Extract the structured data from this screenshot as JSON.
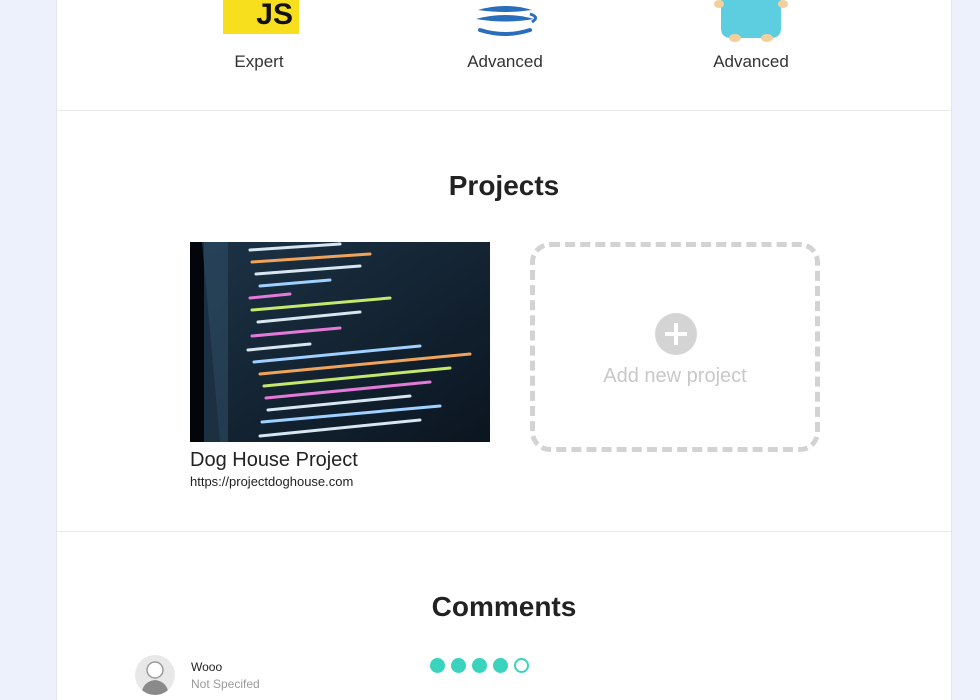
{
  "skills": [
    {
      "icon": "javascript-logo-icon",
      "logo_text": "JS",
      "level": "Expert"
    },
    {
      "icon": "java-logo-icon",
      "level": "Advanced"
    },
    {
      "icon": "go-gopher-logo-icon",
      "level": "Advanced"
    }
  ],
  "projects": {
    "title": "Projects",
    "items": [
      {
        "name": "Dog House Project",
        "url": "https://projectdoghouse.com",
        "thumbnail_icon": "code-screenshot-icon"
      }
    ],
    "add_label": "Add new project"
  },
  "comments": {
    "title": "Comments",
    "items": [
      {
        "author": "Wooo",
        "meta": "Not Specifed",
        "rating": 4,
        "rating_max": 5
      }
    ]
  },
  "colors": {
    "accent": "#3ad3bd",
    "js_yellow": "#f7df1e",
    "page_bg": "#edf1fb"
  }
}
